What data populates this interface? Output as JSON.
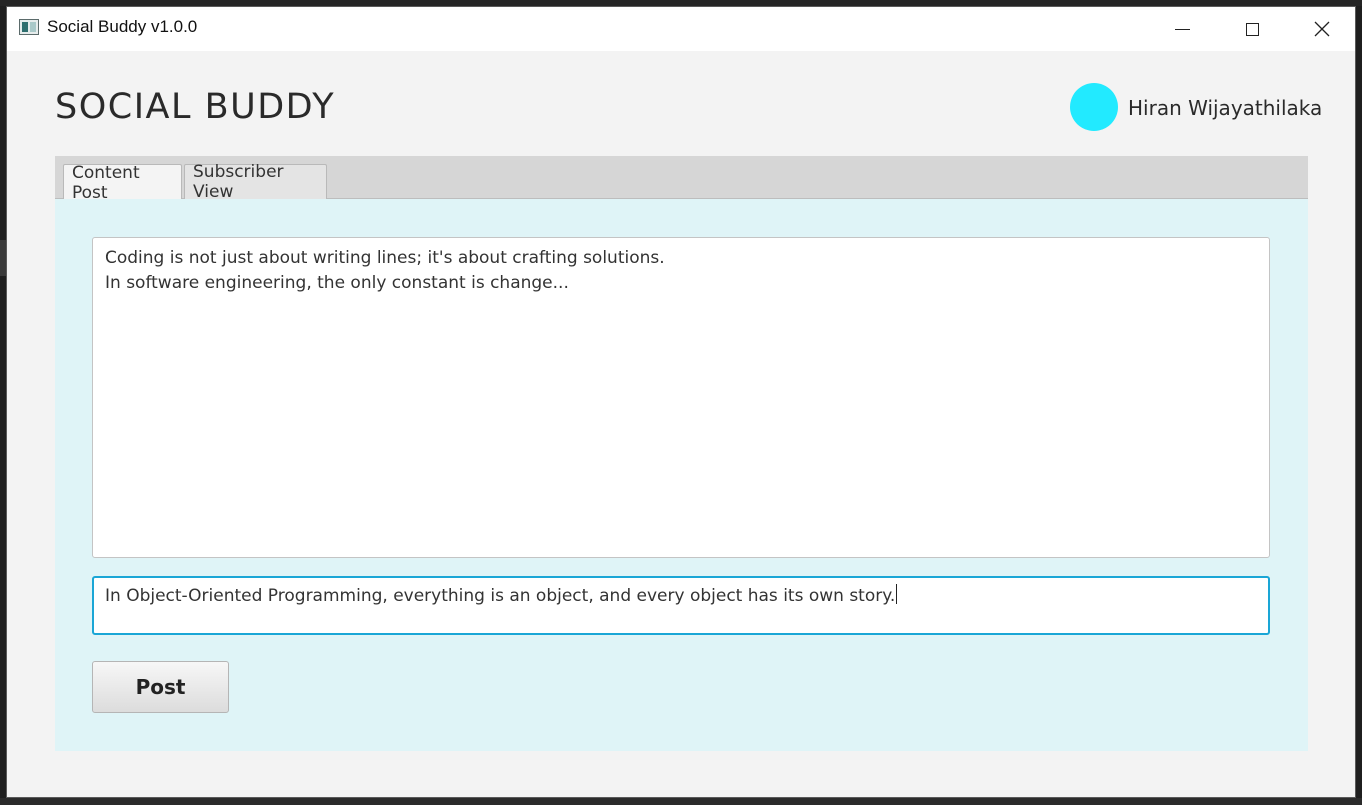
{
  "window": {
    "title": "Social Buddy v1.0.0"
  },
  "header": {
    "app_title": "SOCIAL BUDDY",
    "user_name": "Hiran Wijayathilaka",
    "avatar_color": "#22eaff"
  },
  "tabs": [
    {
      "label": "Content Post",
      "selected": true
    },
    {
      "label": "Subscriber View",
      "selected": false
    }
  ],
  "content": {
    "posts": [
      "Coding is not just about writing lines; it's about crafting solutions.",
      "In software engineering, the only constant is change..."
    ],
    "input_value": "In Object-Oriented Programming, everything is an object, and every object has its own story.",
    "post_button_label": "Post"
  },
  "colors": {
    "tab_body_background": "#dff4f7",
    "input_focus_border": "#1aa6d6"
  }
}
